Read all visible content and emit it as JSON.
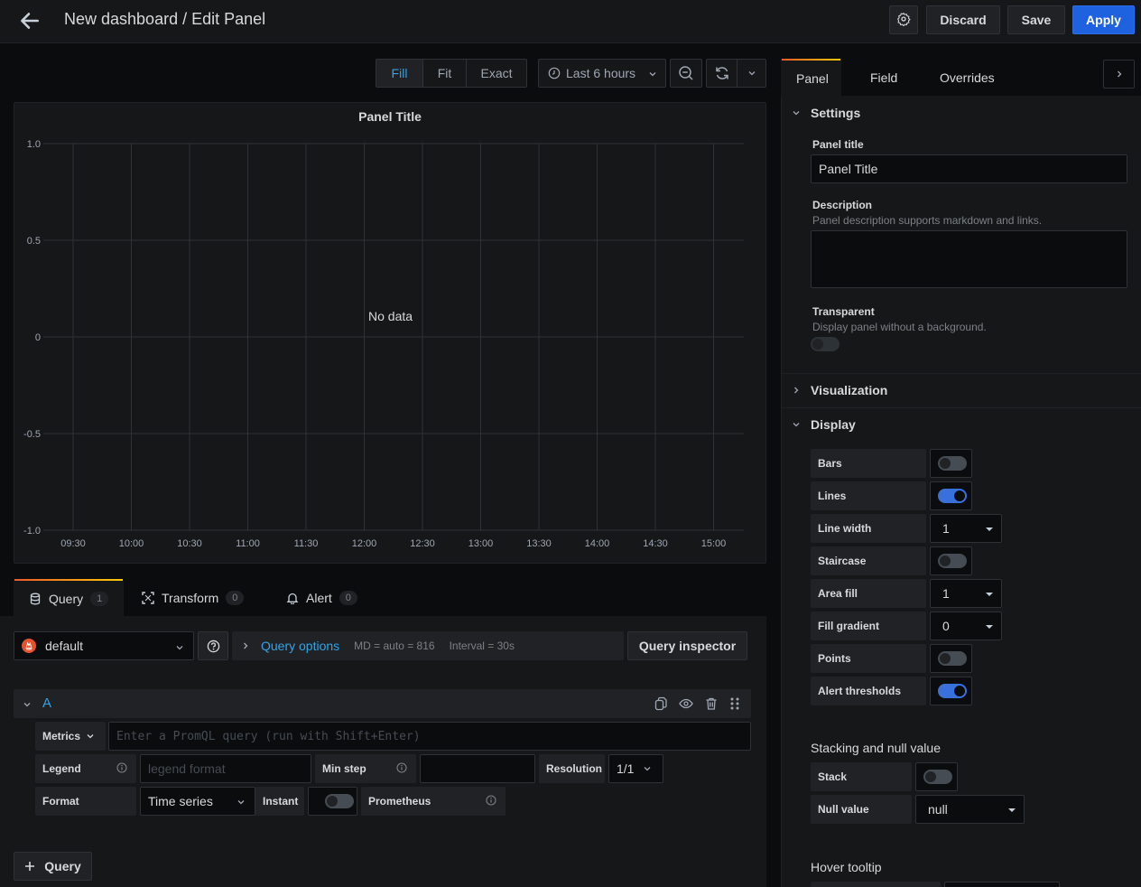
{
  "header": {
    "title": "New dashboard / Edit Panel",
    "buttons": {
      "settings_icon": "gear-icon",
      "discard": "Discard",
      "save": "Save",
      "apply": "Apply"
    }
  },
  "toolbar": {
    "size_modes": [
      {
        "label": "Fill",
        "active": true
      },
      {
        "label": "Fit",
        "active": false
      },
      {
        "label": "Exact",
        "active": false
      }
    ],
    "time_range": "Last 6 hours",
    "icons": [
      "clock-icon",
      "zoom-out-icon",
      "refresh-icon",
      "chevron-down-icon"
    ]
  },
  "panel": {
    "title": "Panel Title",
    "no_data": "No data"
  },
  "chart_data": {
    "type": "line",
    "title": "Panel Title",
    "xlabel": "",
    "ylabel": "",
    "x_ticks": [
      "09:30",
      "10:00",
      "10:30",
      "11:00",
      "11:30",
      "12:00",
      "12:30",
      "13:00",
      "13:30",
      "14:00",
      "14:30",
      "15:00"
    ],
    "y_ticks": [
      "1.0",
      "0.5",
      "0",
      "-0.5",
      "-1.0"
    ],
    "ylim": [
      -1.0,
      1.0
    ],
    "series": [],
    "grid": true,
    "annotation": "No data"
  },
  "query_tabs": [
    {
      "label": "Query",
      "count": "1",
      "icon": "database-icon",
      "active": true
    },
    {
      "label": "Transform",
      "count": "0",
      "icon": "transform-icon",
      "active": false
    },
    {
      "label": "Alert",
      "count": "0",
      "icon": "bell-icon",
      "active": false
    }
  ],
  "query_bar": {
    "datasource": "default",
    "query_options_label": "Query options",
    "md": "MD = auto = 816",
    "interval": "Interval = 30s",
    "query_inspector": "Query inspector"
  },
  "query_row": {
    "ref_id": "A",
    "metrics_label": "Metrics",
    "metrics_placeholder": "Enter a PromQL query (run with Shift+Enter)",
    "legend_label": "Legend",
    "legend_placeholder": "legend format",
    "min_step_label": "Min step",
    "min_step_value": "",
    "resolution_label": "Resolution",
    "resolution_value": "1/1",
    "format_label": "Format",
    "format_value": "Time series",
    "instant_label": "Instant",
    "instant_on": false,
    "prometheus_label": "Prometheus"
  },
  "add_query": "Query",
  "options": {
    "tabs": [
      {
        "label": "Panel",
        "active": true
      },
      {
        "label": "Field",
        "active": false
      },
      {
        "label": "Overrides",
        "active": false
      }
    ],
    "settings": {
      "heading": "Settings",
      "panel_title_label": "Panel title",
      "panel_title_value": "Panel Title",
      "description_label": "Description",
      "description_help": "Panel description supports markdown and links.",
      "description_value": "",
      "transparent_label": "Transparent",
      "transparent_help": "Display panel without a background.",
      "transparent_on": false
    },
    "visualization": {
      "heading": "Visualization"
    },
    "display": {
      "heading": "Display",
      "rows": [
        {
          "label": "Bars",
          "type": "toggle",
          "on": false
        },
        {
          "label": "Lines",
          "type": "toggle",
          "on": true
        },
        {
          "label": "Line width",
          "type": "select",
          "value": "1"
        },
        {
          "label": "Staircase",
          "type": "toggle",
          "on": false
        },
        {
          "label": "Area fill",
          "type": "select",
          "value": "1"
        },
        {
          "label": "Fill gradient",
          "type": "select",
          "value": "0"
        },
        {
          "label": "Points",
          "type": "toggle",
          "on": false
        },
        {
          "label": "Alert thresholds",
          "type": "toggle",
          "on": true
        }
      ],
      "stacking_heading": "Stacking and null value",
      "stack_label": "Stack",
      "stack_on": false,
      "null_value_label": "Null value",
      "null_value": "null",
      "hover_tooltip_heading": "Hover tooltip"
    }
  }
}
